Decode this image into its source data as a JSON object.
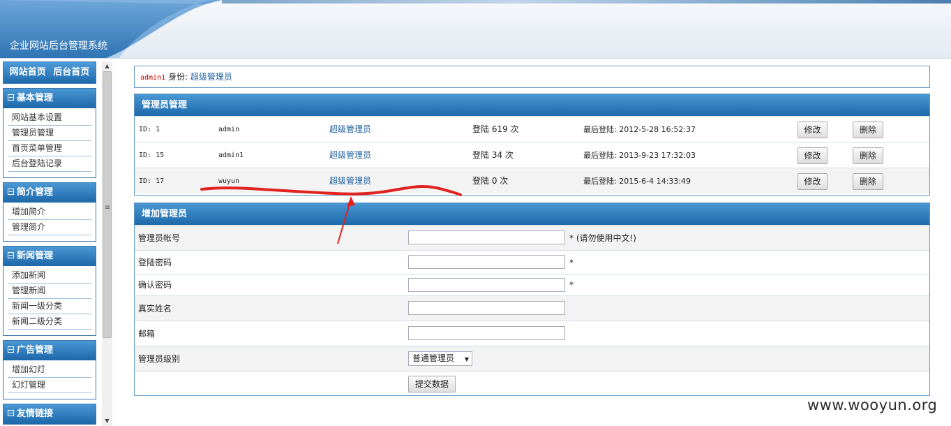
{
  "header": {
    "title": "企业网站后台管理系统"
  },
  "sidebar": {
    "home_links": [
      "网站首页",
      "后台首页"
    ],
    "menus": [
      {
        "title": "基本管理",
        "items": [
          "网站基本设置",
          "管理员管理",
          "首页菜单管理",
          "后台登陆记录"
        ]
      },
      {
        "title": "简介管理",
        "items": [
          "增加简介",
          "管理简介"
        ]
      },
      {
        "title": "新闻管理",
        "items": [
          "添加新闻",
          "管理新闻",
          "新闻一级分类",
          "新闻二级分类"
        ]
      },
      {
        "title": "广告管理",
        "items": [
          "增加幻灯",
          "幻灯管理"
        ]
      },
      {
        "title": "友情链接",
        "items": []
      }
    ]
  },
  "userbar": {
    "username": "admin1",
    "identity_label": "身份:",
    "role": "超级管理员"
  },
  "admins": {
    "title": "管理员管理",
    "edit_label": "修改",
    "delete_label": "删除",
    "rows": [
      {
        "id": "ID: 1",
        "name": "admin",
        "role": "超级管理员",
        "logins": "登陆 619 次",
        "last_login": "最后登陆: 2012-5-28 16:52:37"
      },
      {
        "id": "ID: 15",
        "name": "admin1",
        "role": "超级管理员",
        "logins": "登陆 34 次",
        "last_login": "最后登陆: 2013-9-23 17:32:03"
      },
      {
        "id": "ID: 17",
        "name": "wuyun",
        "role": "超级管理员",
        "logins": "登陆 0 次",
        "last_login": "最后登陆: 2015-6-4 14:33:49"
      }
    ]
  },
  "add_form": {
    "title": "增加管理员",
    "fields": {
      "account": {
        "label": "管理员帐号",
        "value": "",
        "note": "* (请勿使用中文!)"
      },
      "password": {
        "label": "登陆密码",
        "value": "",
        "note": "*"
      },
      "confirm": {
        "label": "确认密码",
        "value": "",
        "note": "*"
      },
      "realname": {
        "label": "真实姓名",
        "value": ""
      },
      "email": {
        "label": "邮箱",
        "value": ""
      },
      "level": {
        "label": "管理员级别",
        "selected": "普通管理员"
      }
    },
    "submit_label": "提交数据"
  },
  "watermark": "www.wooyun.org",
  "colors": {
    "panel_header": "#1d69aa",
    "role_link": "#1f5f9e",
    "annotation": "#e0231f"
  }
}
